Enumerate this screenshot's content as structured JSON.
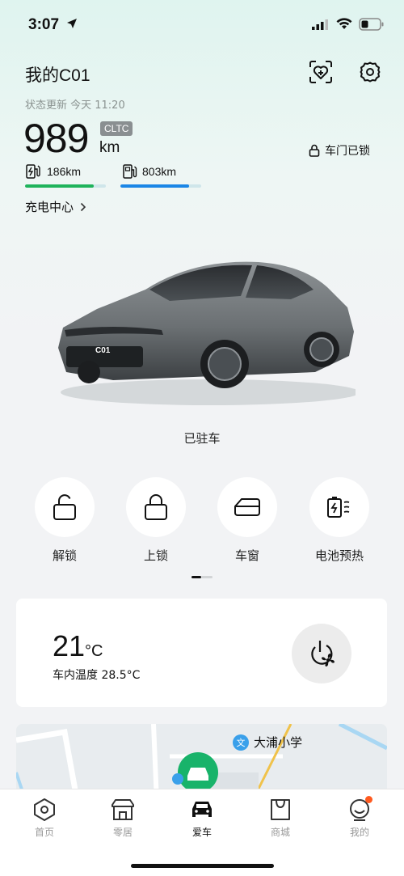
{
  "status_bar": {
    "time": "3:07"
  },
  "header": {
    "car_name": "我的C01"
  },
  "status": {
    "update_text": "状态更新 今天 11:20"
  },
  "range": {
    "value": "989",
    "badge": "CLTC",
    "unit": "km",
    "electric": "186km",
    "fuel": "803km",
    "electric_fraction": 0.85,
    "fuel_fraction": 0.85,
    "electric_color": "#1fb35b",
    "fuel_color": "#1a86e6"
  },
  "door": {
    "status": "车门已锁"
  },
  "charging": {
    "label": "充电中心"
  },
  "car": {
    "plate_text": "C01",
    "state": "已驻车"
  },
  "controls": [
    {
      "label": "解锁",
      "icon": "unlock-icon"
    },
    {
      "label": "上锁",
      "icon": "lock-icon"
    },
    {
      "label": "车窗",
      "icon": "window-icon"
    },
    {
      "label": "电池预热",
      "icon": "battery-heat-icon"
    }
  ],
  "climate": {
    "temp": "21",
    "temp_unit": "°C",
    "inside": "车内温度 28.5°C"
  },
  "map": {
    "poi_badge": "文",
    "poi_name": "大浦小学"
  },
  "tabs": [
    {
      "label": "首页",
      "icon": "home-icon"
    },
    {
      "label": "零居",
      "icon": "store-icon"
    },
    {
      "label": "爱车",
      "icon": "car-icon",
      "active": true
    },
    {
      "label": "商城",
      "icon": "shop-icon"
    },
    {
      "label": "我的",
      "icon": "profile-icon"
    }
  ],
  "colors": {
    "accent": "#1fb35b",
    "map_marker": "#18b36a",
    "notification": "#ff5a1f"
  }
}
